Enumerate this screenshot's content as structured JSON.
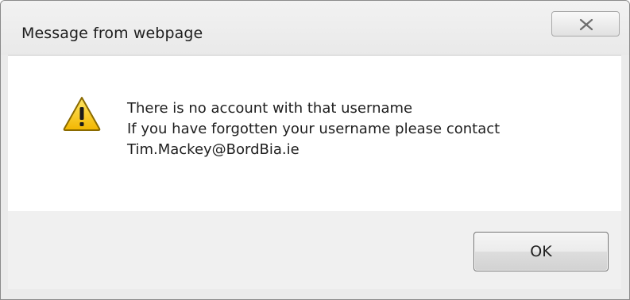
{
  "dialog": {
    "title": "Message from webpage",
    "close_icon": "close-icon",
    "warning_icon": "warning-icon",
    "message_lines": [
      "There is no account with that username",
      "If you have forgotten your username please contact",
      "Tim.Mackey@BordBia.ie"
    ],
    "ok_label": "OK"
  },
  "colors": {
    "warning_fill": "#f5c400",
    "warning_border": "#8a6a00",
    "content_bg": "#ffffff",
    "footer_bg": "#f0f0f0"
  }
}
